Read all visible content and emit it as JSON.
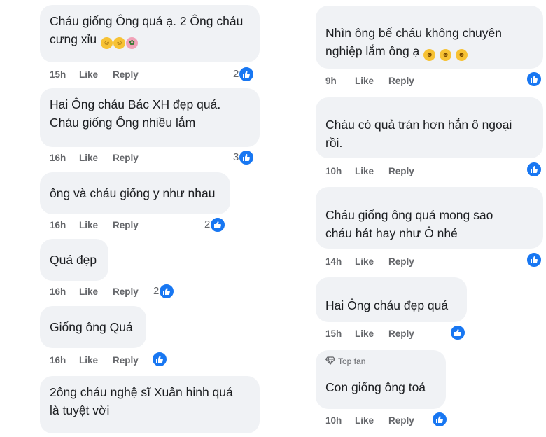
{
  "left_comments": [
    {
      "lines": [
        "Cháu giống Ông quá ạ. 2 Ông cháu",
        "cưng xỉu"
      ],
      "emojis": [
        "face-blowing-kiss",
        "face-blowing-kiss",
        "bouquet"
      ],
      "time": "15h",
      "like": "Like",
      "reply": "Reply",
      "count": "2"
    },
    {
      "lines": [
        "Hai Ông cháu Bác XH đẹp quá.",
        "Cháu giống Ông nhiều lắm"
      ],
      "emojis": [],
      "time": "16h",
      "like": "Like",
      "reply": "Reply",
      "count": "3"
    },
    {
      "lines": [
        "ông và cháu giống y như nhau"
      ],
      "emojis": [],
      "time": "16h",
      "like": "Like",
      "reply": "Reply",
      "count": "2"
    },
    {
      "lines": [
        "Quá đẹp"
      ],
      "emojis": [],
      "time": "16h",
      "like": "Like",
      "reply": "Reply",
      "count": "2"
    },
    {
      "lines": [
        "Giống ông Quá"
      ],
      "emojis": [],
      "time": "16h",
      "like": "Like",
      "reply": "Reply",
      "count": ""
    },
    {
      "lines": [
        "2ông cháu nghệ sĩ Xuân hinh quá",
        "là tuyệt vời"
      ],
      "emojis": [],
      "time": "",
      "like": "",
      "reply": "",
      "count": ""
    }
  ],
  "right_comments": [
    {
      "lines": [
        "Nhìn ông bế cháu không chuyên",
        "nghiệp lắm ông ạ"
      ],
      "emojis": [
        "grinning-face",
        "grinning-face",
        "grinning-face"
      ],
      "time": "9h",
      "like": "Like",
      "reply": "Reply",
      "count": ""
    },
    {
      "lines": [
        "Cháu có quả trán hơn hẳn ô ngoại",
        "rồi."
      ],
      "emojis": [],
      "time": "10h",
      "like": "Like",
      "reply": "Reply",
      "count": ""
    },
    {
      "lines": [
        "Cháu giống ông quá mong sao",
        "cháu hát hay như Ô nhé"
      ],
      "emojis": [],
      "time": "14h",
      "like": "Like",
      "reply": "Reply",
      "count": ""
    },
    {
      "lines": [
        "Hai Ông cháu đẹp quá"
      ],
      "emojis": [],
      "time": "15h",
      "like": "Like",
      "reply": "Reply",
      "count": ""
    },
    {
      "badge": "Top fan",
      "lines": [
        "Con giống ông toá"
      ],
      "emojis": [],
      "time": "10h",
      "like": "Like",
      "reply": "Reply",
      "count": ""
    }
  ],
  "icons": {
    "reaction": "like-thumb-icon",
    "badge": "diamond-icon"
  },
  "colors": {
    "bubble": "#f0f2f5",
    "meta": "#65676b",
    "like_blue": "#1877f2"
  }
}
